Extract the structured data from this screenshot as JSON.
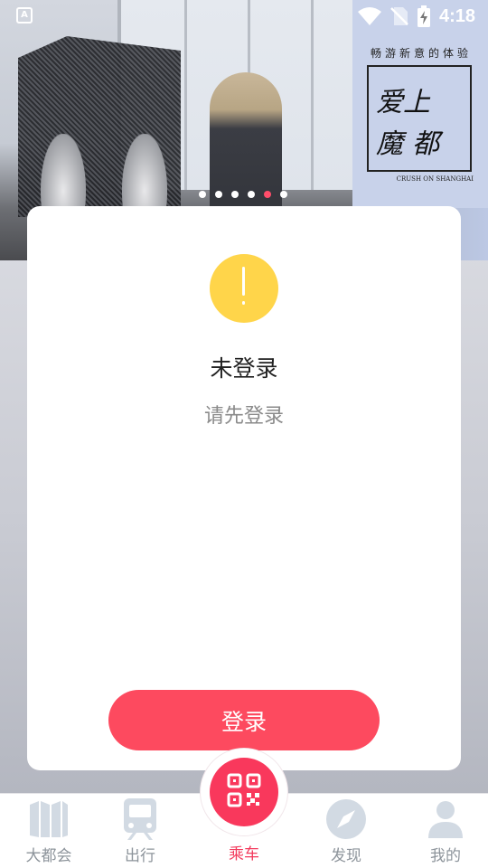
{
  "banner": {
    "poster_tagline": "畅游新意的体验",
    "poster_title_line1": "爱上",
    "poster_title_line2": "魔都",
    "poster_subtitle": "CRUSH ON SHANGHAI",
    "page_count": 6,
    "active_page": 5
  },
  "status_bar": {
    "time": "4:18",
    "left_badge": "A"
  },
  "dialog": {
    "title": "未登录",
    "message": "请先登录",
    "login_label": "登录"
  },
  "nav": {
    "items": [
      {
        "label": "大都会",
        "icon": "book-icon"
      },
      {
        "label": "出行",
        "icon": "train-icon"
      },
      {
        "label": "乘车",
        "icon": "qr-code-icon"
      },
      {
        "label": "发现",
        "icon": "compass-icon"
      },
      {
        "label": "我的",
        "icon": "user-icon"
      }
    ],
    "active_index": 2
  },
  "colors": {
    "accent": "#fd4a5f",
    "warning": "#ffd54a",
    "nav_inactive": "#8d949b",
    "nav_icon": "#d2dae3"
  }
}
